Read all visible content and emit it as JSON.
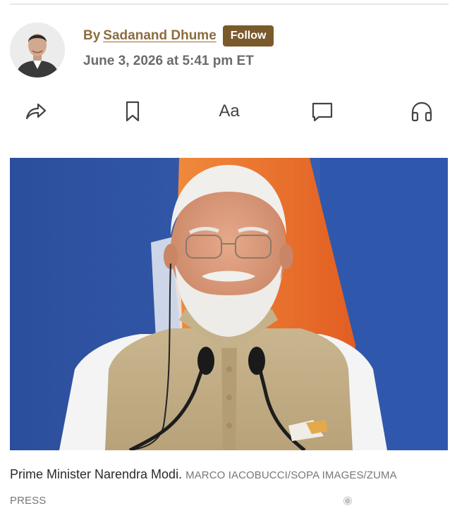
{
  "byline": {
    "by_prefix": "By",
    "author": "Sadanand Dhume",
    "follow_label": "Follow",
    "timestamp": "June 3, 2026 at 5:41 pm ET"
  },
  "toolbar": {
    "share_icon": "share-icon",
    "save_icon": "bookmark-icon",
    "text_size_label": "Aa",
    "comments_icon": "comment-icon",
    "listen_icon": "headphones-icon"
  },
  "photo": {
    "caption": "Prime Minister Narendra Modi.",
    "credit": "MARCO IACOBUCCI/SOPA IMAGES/ZUMA PRESS"
  },
  "colors": {
    "accent": "#8c6d3f",
    "follow_bg": "#7a5a2c",
    "flag_blue": "#2e56a8",
    "flag_orange": "#e8722c"
  }
}
